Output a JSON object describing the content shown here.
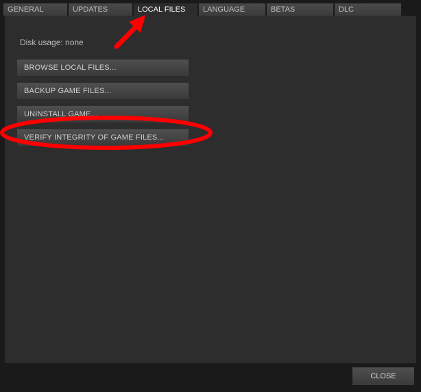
{
  "tabs": [
    {
      "label": "GENERAL",
      "active": false
    },
    {
      "label": "UPDATES",
      "active": false
    },
    {
      "label": "LOCAL FILES",
      "active": true
    },
    {
      "label": "LANGUAGE",
      "active": false
    },
    {
      "label": "BETAS",
      "active": false
    },
    {
      "label": "DLC",
      "active": false
    }
  ],
  "disk_usage_label": "Disk usage: none",
  "buttons": {
    "browse": "BROWSE LOCAL FILES...",
    "backup": "BACKUP GAME FILES...",
    "uninstall": "UNINSTALL GAME...",
    "verify": "VERIFY INTEGRITY OF GAME FILES..."
  },
  "close_label": "CLOSE",
  "annotation": {
    "arrow_color": "#ff0000",
    "ellipse_color": "#ff0000"
  }
}
